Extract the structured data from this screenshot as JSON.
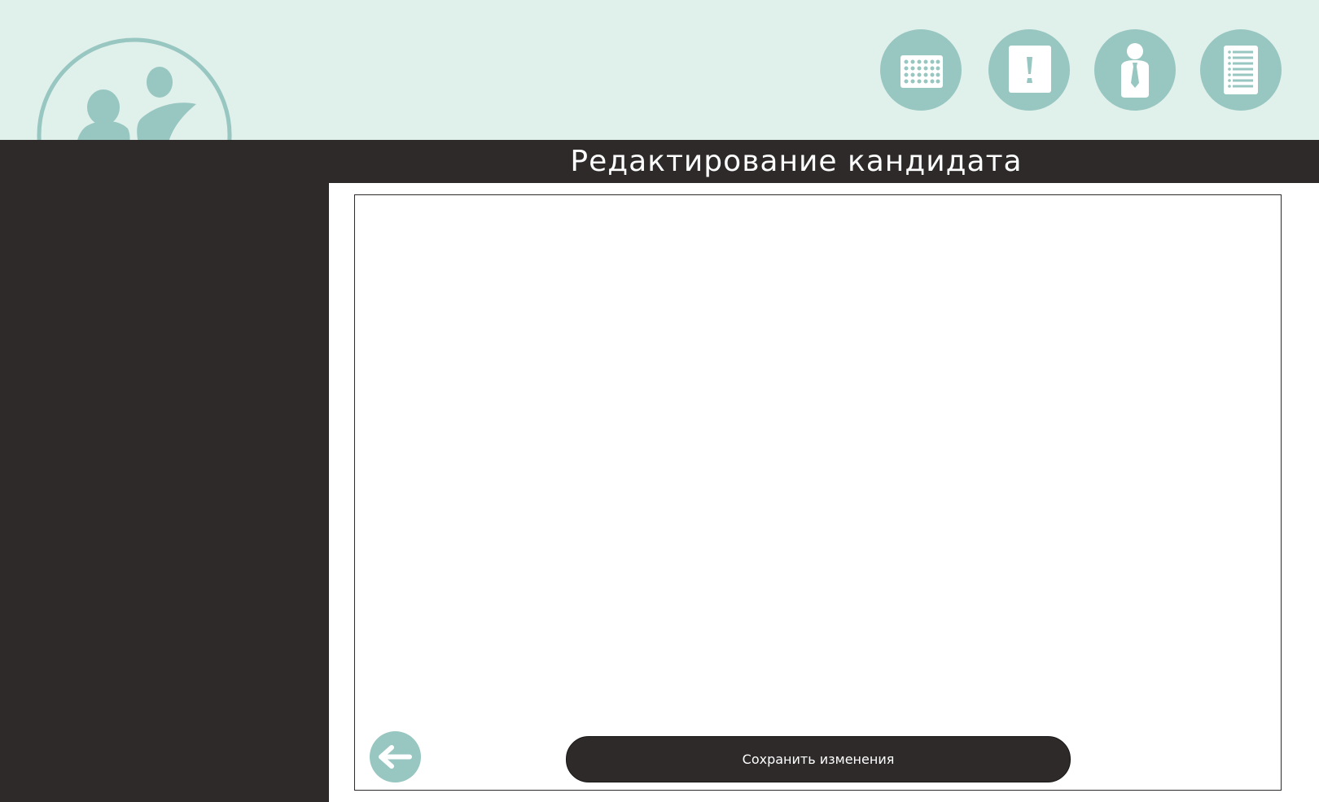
{
  "header": {
    "title": "Редактирование кандидата"
  },
  "nav": {
    "items": [
      {
        "icon": "calendar-grid-icon"
      },
      {
        "icon": "alert-document-icon"
      },
      {
        "icon": "person-tie-icon"
      },
      {
        "icon": "list-document-icon"
      }
    ]
  },
  "logo": {
    "icon": "people-circle-logo-icon"
  },
  "actions": {
    "save_label": "Сохранить изменения",
    "back_icon": "arrow-left-icon"
  },
  "colors": {
    "accent": "#98c6c1",
    "dark": "#2e2a2a",
    "header_bg": "#e0f0eb",
    "panel_bg": "#ffffff"
  }
}
